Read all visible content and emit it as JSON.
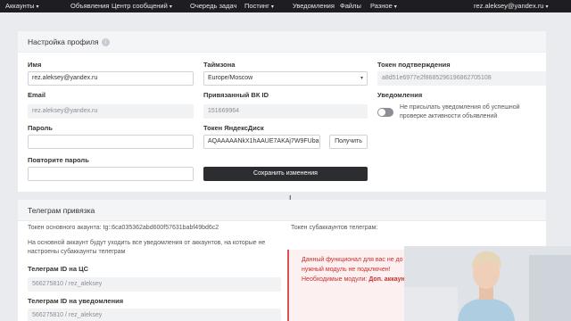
{
  "nav": {
    "items": [
      {
        "label": "Аккаунты",
        "caret": true
      },
      {
        "label": "Объявления",
        "caret": false
      },
      {
        "label": "Центр сообщений",
        "caret": true
      },
      {
        "label": "Очередь задач",
        "caret": false
      },
      {
        "label": "Постинг",
        "caret": true
      },
      {
        "label": "Уведомления",
        "caret": false
      },
      {
        "label": "Файлы",
        "caret": false
      },
      {
        "label": "Разное",
        "caret": true
      }
    ],
    "user": "rez.aleksey@yandex.ru"
  },
  "profile": {
    "title": "Настройка профиля",
    "info_icon": "i",
    "name_label": "Имя",
    "name_value": "rez.aleksey@yandex.ru",
    "email_label": "Email",
    "email_value": "rez.aleksey@yandex.ru",
    "password_label": "Пароль",
    "password_value": "",
    "repeat_password_label": "Повторите пароль",
    "repeat_password_value": "",
    "timezone_label": "Таймзона",
    "timezone_value": "Europe/Moscow",
    "vk_label": "Привязанный ВК ID",
    "vk_value": "151669964",
    "yadisk_label": "Токен ЯндексДиск",
    "yadisk_value": "AQAAAAANkX1hAAUE7AKAj7W9FUba",
    "get_button": "Получить",
    "save_button": "Сохранить изменения",
    "confirm_token_label": "Токен подтверждения",
    "confirm_token_value": "a8d51e6977e2f8685296196862705108",
    "notifications_label": "Уведомления",
    "notifications_text": "Не присылать уведомления об успешной проверке активности объявлений"
  },
  "telegram": {
    "title": "Телеграм привязка",
    "main_token_text": "Токен основного акаунта: tg::6ca035362abd600f57631babf49bd6c2",
    "main_notice": "На основной аккаунт будут уходить все уведомления от аккаунтов, на которые не настроены субаккаунты телеграм",
    "id_cs_label": "Телеграм ID на ЦС",
    "id_cs_value": "566275810 / rez_aleksey",
    "id_notif_label": "Телеграм ID на уведомления",
    "id_notif_value": "566275810 / rez_aleksey",
    "sub_token_text": "Токен субаккаунтов телеграм:",
    "alert_line1": "Данный функционал для вас не до",
    "alert_line2": "нужный модуль не подключен!",
    "alert_line3_prefix": "Необходимые модули:",
    "alert_line3_link": "Доп. аккаун"
  },
  "colors": {
    "topbar": "#1e1e22",
    "primary_button": "#2b2d31",
    "alert_text": "#c9302c",
    "alert_bg": "#fdf0f0"
  }
}
